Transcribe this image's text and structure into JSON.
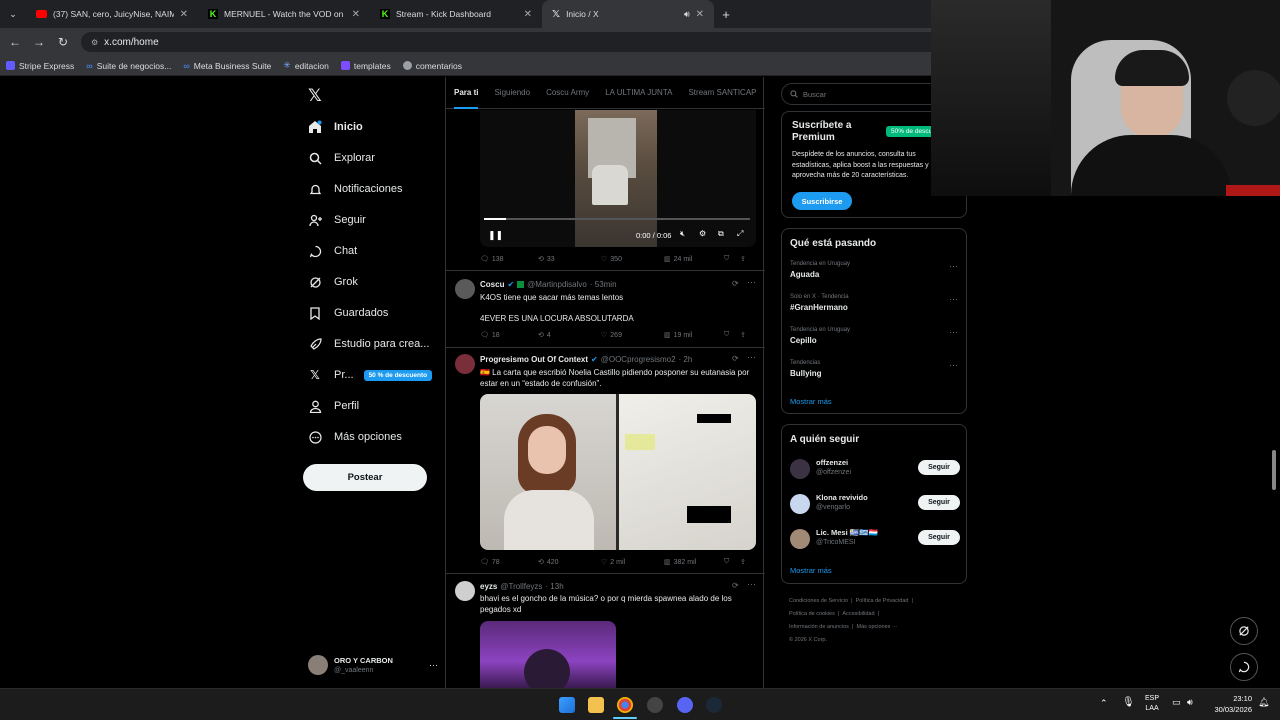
{
  "browser": {
    "tabs": [
      {
        "title": "(37) SAN, cero, JuicyNise, NAIM",
        "icon": "youtube-icon"
      },
      {
        "title": "MERNUEL - Watch the VOD on",
        "icon": "kick-icon"
      },
      {
        "title": "Stream - Kick Dashboard",
        "icon": "kick-icon"
      },
      {
        "title": "Inicio / X",
        "icon": "x-logo-icon"
      }
    ],
    "url": "x.com/home",
    "bookmarks": [
      "Stripe Express",
      "Suite de negocios...",
      "Meta Business Suite",
      "editacion",
      "templates",
      "comentarios"
    ]
  },
  "nav": {
    "items": [
      {
        "label": "Inicio",
        "icon": "home-icon"
      },
      {
        "label": "Explorar",
        "icon": "search-icon"
      },
      {
        "label": "Notificaciones",
        "icon": "bell-icon"
      },
      {
        "label": "Seguir",
        "icon": "add-user-icon"
      },
      {
        "label": "Chat",
        "icon": "chat-icon"
      },
      {
        "label": "Grok",
        "icon": "grok-icon"
      },
      {
        "label": "Guardados",
        "icon": "bookmark-icon"
      },
      {
        "label": "Estudio para crea...",
        "icon": "rocket-icon"
      },
      {
        "label": "Pr...",
        "icon": "x-logo-icon"
      },
      {
        "label": "Perfil",
        "icon": "user-icon"
      },
      {
        "label": "Más opciones",
        "icon": "more-icon"
      }
    ],
    "premium_badge": "50 % de descuento",
    "post_label": "Postear",
    "profile_name": "ORO Y CARBON",
    "profile_handle": "@_vaaleenn"
  },
  "feed": {
    "tabs": [
      "Para ti",
      "Siguiendo",
      "Coscu Army",
      "LA ULTIMA JUNTA",
      "Stream SANTICAP"
    ],
    "video": {
      "time": "0:00 / 0:06"
    },
    "tweet0_actions": {
      "replies": "138",
      "reposts": "33",
      "likes": "350",
      "views": "24 mil"
    },
    "tweets": [
      {
        "name": "Coscu",
        "handle": "@Martinpdisalvo",
        "time": "· 53min",
        "text1": "K4OS tiene que sacar más temas lentos",
        "text2": "4EVER ES UNA LOCURA ABSOLUTARDA",
        "replies": "18",
        "reposts": "4",
        "likes": "269",
        "views": "19 mil"
      },
      {
        "name": "Progresismo Out Of Context",
        "handle": "@OOCprogresismo2",
        "time": "· 2h",
        "text1": "🇪🇸 La carta que escribió Noelia Castillo pidiendo posponer su eutanasia por estar en un “estado de confusión”.",
        "replies": "78",
        "reposts": "420",
        "likes": "2 mil",
        "views": "382 mil"
      },
      {
        "name": "eyzs",
        "handle": "@Trollfeyzs",
        "time": "· 13h",
        "text1": "bhavi es el goncho de la música? o por q mierda spawnea alado de los pegados xd"
      }
    ]
  },
  "right": {
    "search_placeholder": "Buscar",
    "premium_title": "Suscríbete a Premium",
    "premium_badge": "50% de descu",
    "premium_text": "Despídete de los anuncios, consulta tus estadísticas, aplica boost a las respuestas y aprovecha más de 20 características.",
    "premium_button": "Suscribirse",
    "trends_title": "Qué está pasando",
    "trends": [
      {
        "context": "Tendencia en Uruguay",
        "name": "Aguada"
      },
      {
        "context": "Solo en X · Tendencia",
        "name": "#GranHermano"
      },
      {
        "context": "Tendencia en Uruguay",
        "name": "Cepillo"
      },
      {
        "context": "Tendencias",
        "name": "Bullying"
      }
    ],
    "show_more": "Mostrar más",
    "follow_title": "A quién seguir",
    "follow": [
      {
        "name": "offzenzei",
        "handle": "@offzenzei"
      },
      {
        "name": "Klona revivido",
        "handle": "@vengarlo"
      },
      {
        "name": "Lic. Mesi 🇺🇾🇬🇷🇱🇺",
        "handle": "@TricoMESI"
      }
    ],
    "follow_button": "Seguir",
    "footer": [
      "Condiciones de Servicio",
      "Política de Privacidad",
      "Política de cookies",
      "Accesibilidad",
      "Información de anuncios",
      "Más opciones ···",
      "© 2026 X Corp."
    ]
  },
  "taskbar": {
    "lang1": "ESP",
    "lang2": "LAA",
    "time": "23:10",
    "date": "30/03/2026"
  },
  "colors": {
    "accent": "#1d9bf0",
    "premium_green": "#00ba7c"
  }
}
